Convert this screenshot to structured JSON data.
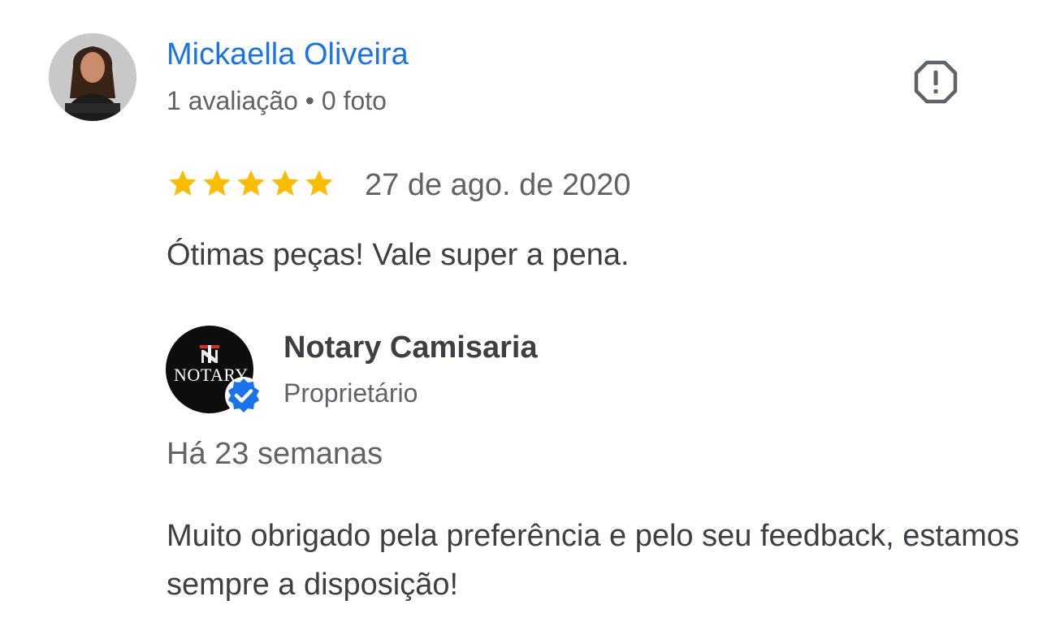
{
  "review": {
    "reviewer_name": "Mickaella Oliveira",
    "reviewer_meta": "1 avaliação • 0 foto",
    "avatar_icon": "reviewer-photo",
    "report_icon": "report-flag-icon",
    "rating": 5,
    "max_rating": 5,
    "star_color": "#fbbc04",
    "date": "27 de ago. de 2020",
    "text": "Ótimas peças! Vale super a pena."
  },
  "owner_reply": {
    "owner_name": "Notary Camisaria",
    "owner_role": "Proprietário",
    "logo_text": "NOTARY",
    "verified_color": "#1a73e8",
    "time": "Há 23 semanas",
    "text": "Muito obrigado pela preferência e pelo seu feedback, estamos sempre a disposição!"
  },
  "colors": {
    "link_blue": "#1a73e8",
    "text_primary": "#3c4043",
    "text_secondary": "#5f6368"
  }
}
